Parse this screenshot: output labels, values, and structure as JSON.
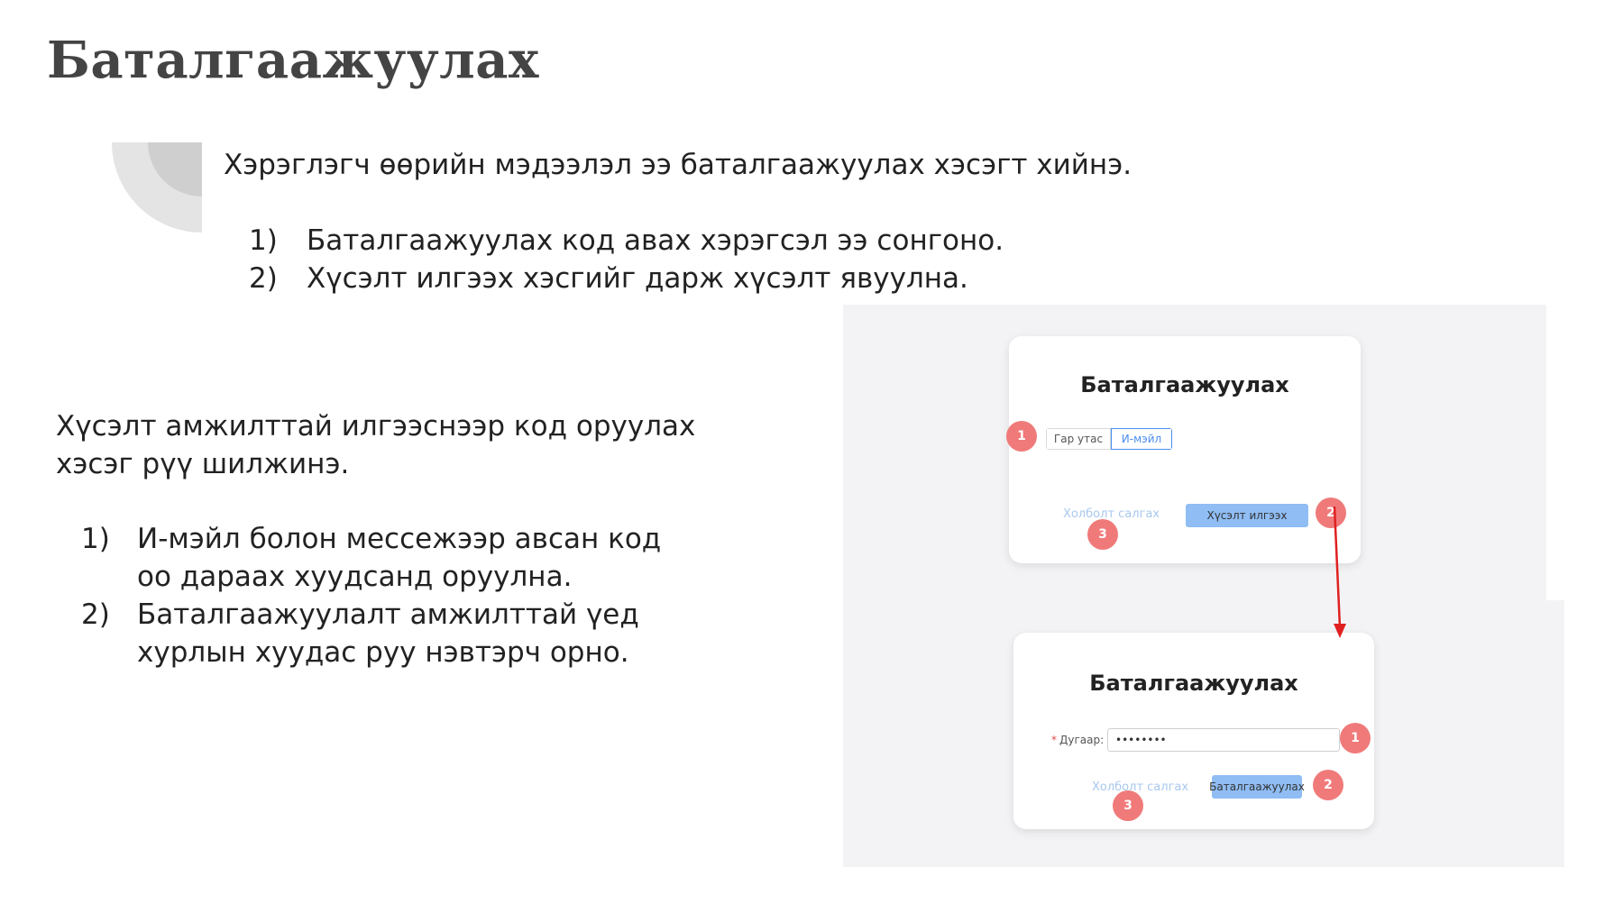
{
  "slide": {
    "title": "Баталгаажуулах",
    "intro": "Хэрэглэгч өөрийн мэдээлэл ээ баталгаажуулах хэсэгт хийнэ.",
    "steps1": [
      {
        "num": "1)",
        "text": "Баталгаажуулах код авах хэрэгсэл ээ сонгоно."
      },
      {
        "num": "2)",
        "text": "Хүсэлт илгээх хэсгийг дарж хүсэлт явуулна."
      }
    ],
    "result": "Хүсэлт амжилттай илгээснээр код оруулах хэсэг рүү шилжинэ.",
    "steps2": [
      {
        "num": "1)",
        "text": "И-мэйл болон мессежээр авсан код оо дараах хуудсанд оруулна."
      },
      {
        "num": "2)",
        "text": "Баталгаажуулалт  амжилттай үед хурлын хуудас руу нэвтэрч орно."
      }
    ]
  },
  "screen1": {
    "title": "Баталгаажуулах",
    "options": [
      "Гар утас",
      "И-мэйл"
    ],
    "cancel": "Холболт салгах",
    "submit": "Хүсэлт илгээх",
    "badges": [
      "1",
      "2",
      "3"
    ]
  },
  "screen2": {
    "title": "Баталгаажуулах",
    "field_label": "Дугаар:",
    "field_value": "••••••••",
    "cancel": "Холболт салгах",
    "submit": "Баталгаажуулах",
    "badges": [
      "1",
      "2",
      "3"
    ]
  },
  "colors": {
    "badge": "#f07a7a",
    "primary": "#8fbdf4",
    "link": "#a8c8ee",
    "arrow": "#e02020"
  }
}
